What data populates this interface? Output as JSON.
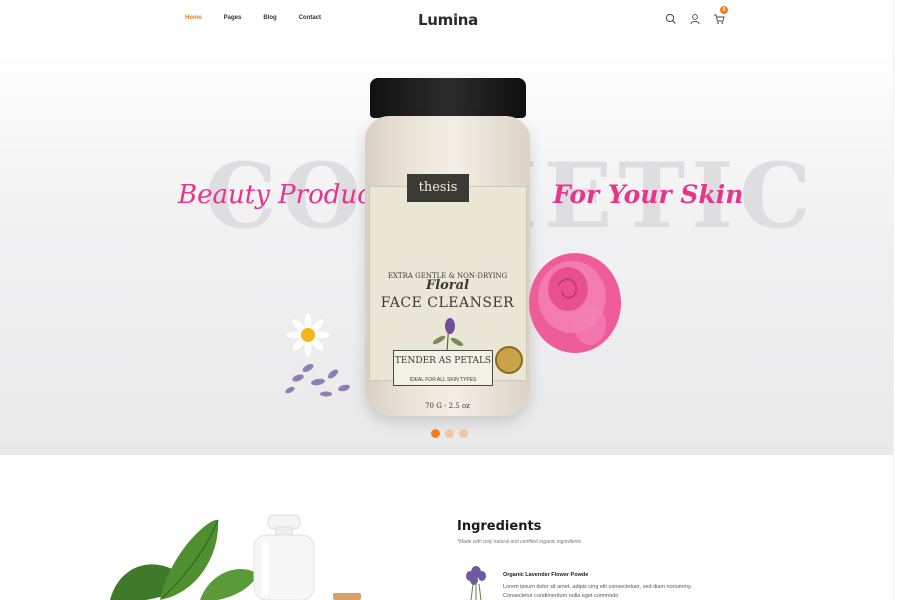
{
  "nav": {
    "items": [
      "Home",
      "Pages",
      "Blog",
      "Contact"
    ],
    "active": "Home"
  },
  "brand": {
    "logo": "Lumina"
  },
  "header_icons": [
    "search-icon",
    "user-icon",
    "cart-icon"
  ],
  "cart": {
    "count": "0"
  },
  "hero": {
    "background_word": "COSMETIC",
    "tagline_left": "Beauty Products",
    "tagline_right": "For Your Skin",
    "product": {
      "brand": "thesis",
      "line1": "EXTRA GENTLE & NON-DRYING",
      "line2": "Floral",
      "line3": "FACE CLEANSER",
      "line4": "TENDER AS PETALS",
      "line5": "IDEAL FOR ALL SKIN TYPES",
      "weight": "70 G - 2.5 oz"
    },
    "slides": {
      "count": 3,
      "active_index": 0
    }
  },
  "ingredients": {
    "title": "Ingredients",
    "subtitle": "*Made with only natural and certified organic ingredients",
    "items": [
      {
        "title": "Organic Lavender Flower Powde",
        "description": "Lorem ipsum dolor sit amet, adipis cing elit consectetuer, sed diam nonummy. Consectetur condimentum nulla eget commodo"
      }
    ]
  },
  "colors": {
    "accent": "#f07c1e",
    "tagline": "#e8348b",
    "background_word": "#dedee0"
  }
}
